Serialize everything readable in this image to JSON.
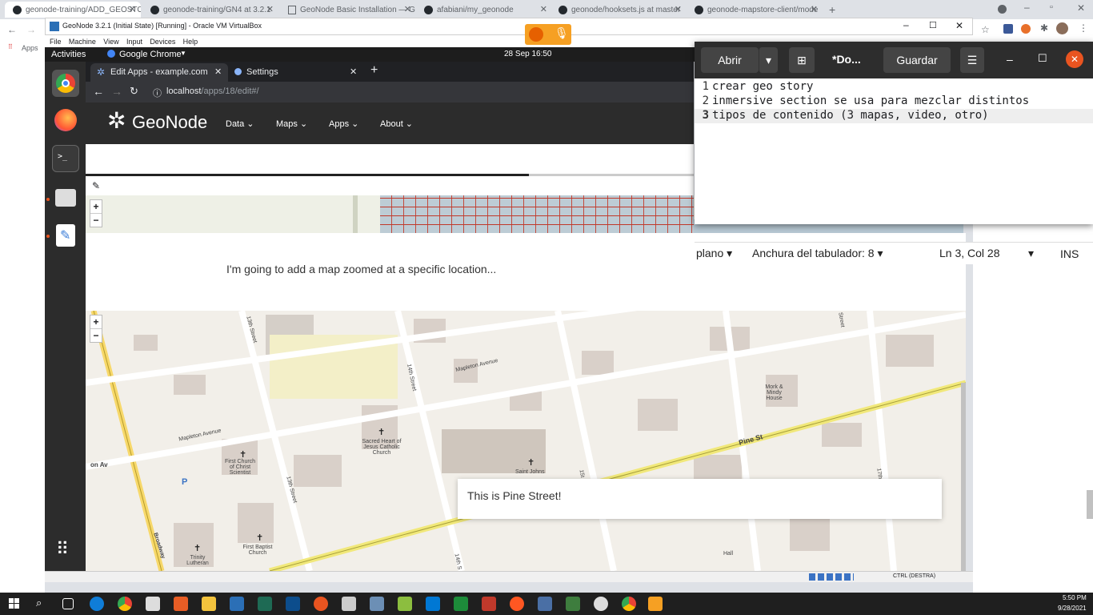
{
  "host_tabs": [
    {
      "label": "geonode-training/ADD_GEOSTO"
    },
    {
      "label": "geonode-training/GN4 at 3.2.1"
    },
    {
      "label": "GeoNode Basic Installation — G"
    },
    {
      "label": "afabiani/my_geonode"
    },
    {
      "label": "geonode/hooksets.js at master"
    },
    {
      "label": "geonode-mapstore-client/mode"
    }
  ],
  "host_apps_label": "Apps",
  "vbox": {
    "title": "GeoNode 3.2.1 (Initial State) [Running] - Oracle VM VirtualBox",
    "menu": [
      "File",
      "Machine",
      "View",
      "Input",
      "Devices",
      "Help"
    ],
    "status_text": "CTRL (DESTRA)"
  },
  "ubuntu": {
    "activities": "Activities",
    "app_menu": "Google Chrome",
    "clock": "28 Sep  16:50"
  },
  "guest_chrome": {
    "tabs": [
      {
        "label": "Edit Apps - example.com"
      },
      {
        "label": "Settings"
      }
    ],
    "url_host": "localhost",
    "url_path": "/apps/18/edit#/"
  },
  "geonode": {
    "logo": "GeoNode",
    "nav": [
      "Data",
      "Maps",
      "Apps",
      "About"
    ]
  },
  "story": {
    "paragraph": "I'm going to add a map zoomed at a specific location...",
    "popup": "This is Pine Street!"
  },
  "map_labels": {
    "mapleton1": "Mapleton Avenue",
    "mapleton2": "Mapleton Avenue",
    "pine": "Pine St",
    "broadway": "Broadway",
    "s13": "13th Street",
    "s13b": "13th Street",
    "s14": "14th Street",
    "s14b": "14th S",
    "s17": "17th",
    "s15": "15t",
    "cs": "First Church of Christ Scientist",
    "sh": "Sacred Heart of Jesus Catholic Church",
    "sj": "Saint Johns",
    "fb": "First Baptist Church",
    "tl": "Trinity Lutheran",
    "mm": "Mork & Mindy House",
    "park": "P",
    "hall": "Hall",
    "street": "Street",
    "pine_av": "on Av"
  },
  "gedit": {
    "open": "Abrir",
    "title": "*Do...",
    "save": "Guardar",
    "lines": [
      {
        "n": "1",
        "text": "crear geo story"
      },
      {
        "n": "2",
        "text": "inmersive section se usa para mezclar distintos"
      },
      {
        "n": "3",
        "text": "tipos de contenido (3 mapas, video, otro)"
      }
    ],
    "lang": "plano",
    "tabwidth": "Anchura del tabulador: 8",
    "position": "Ln 3, Col 28",
    "mode": "INS"
  },
  "taskbar": {
    "time": "5:50 PM",
    "date": "9/28/2021"
  }
}
